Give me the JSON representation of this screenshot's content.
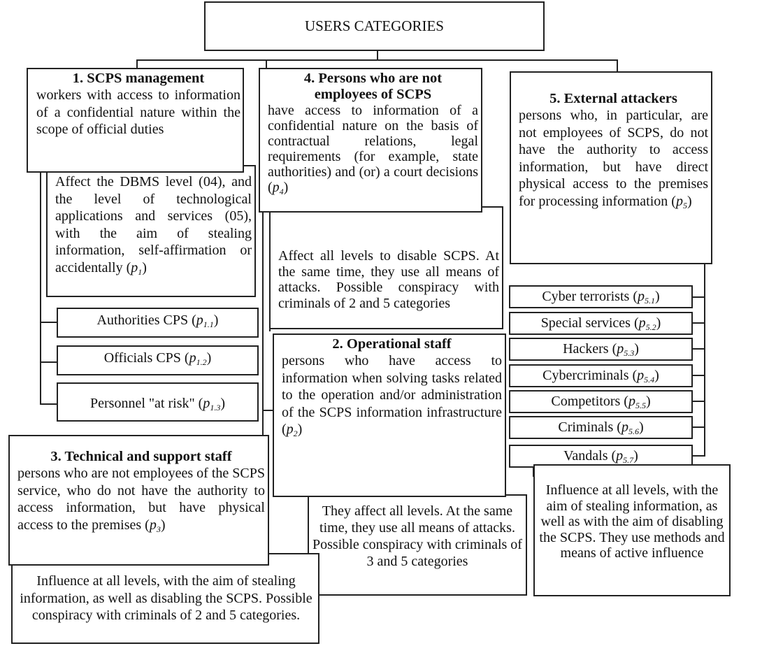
{
  "root": {
    "title": "USERS CATEGORIES"
  },
  "categories": {
    "c1": {
      "title": "1. SCPS management",
      "description": "workers with access to information of a confidential nature within the scope of official duties",
      "impact": "Affect the DBMS level (04), and the level of technological applications and services (05), with the aim of stealing information, self-affirmation or accidentally",
      "impact_param": "p",
      "impact_param_sub": "1",
      "subtypes": [
        {
          "label": "Authorities  CPS",
          "param": "p",
          "sub": "1.1"
        },
        {
          "label": "Officials CPS",
          "param": "p",
          "sub": "1.2"
        },
        {
          "label": "Personnel \"at risk\"",
          "param": "p",
          "sub": "1.3"
        }
      ]
    },
    "c4": {
      "title_line1": "4. Persons who are not",
      "title_line2": "employees of SCPS",
      "description": "have access to information of a confidential nature on the basis of contractual relations, legal requirements (for example, state authorities) and (or) a court decisions",
      "param": "p",
      "param_sub": "4",
      "impact": "Affect all levels to disable SCPS. At the same time, they use all means of attacks. Possible conspiracy with criminals of 2 and 5 categories"
    },
    "c5": {
      "title": "5. External attackers",
      "description": "persons who, in particular, are not employees of SCPS, do not have the authority to access information, but have direct physical access to the premises for processing information",
      "param": "p",
      "param_sub": "5",
      "subtypes": [
        {
          "label": "Cyber terrorists",
          "param": "p",
          "sub": "5.1"
        },
        {
          "label": "Special services",
          "param": "p",
          "sub": "5.2"
        },
        {
          "label": "Hackers",
          "param": "p",
          "sub": "5.3"
        },
        {
          "label": "Cybercriminals",
          "param": "p",
          "sub": "5.4"
        },
        {
          "label": "Competitors",
          "param": "p",
          "sub": "5.5"
        },
        {
          "label": "Criminals",
          "param": "p",
          "sub": "5.6"
        },
        {
          "label": "Vandals",
          "param": "p",
          "sub": "5.7"
        }
      ],
      "impact": "Influence at all levels, with the aim of stealing information, as well as with the aim of disabling the SCPS. They use methods and means of active influence"
    },
    "c2": {
      "title": "2. Operational staff",
      "description": "persons who have access to information when solving tasks related to the operation and/or administration of the SCPS information infrastructure",
      "param": "p",
      "param_sub": "2",
      "impact": "They affect all levels. At the same time, they use all means of attacks. Possible conspiracy with criminals of 3 and 5 categories"
    },
    "c3": {
      "title": "3. Technical and support staff",
      "description": "persons who are not employees of the SCPS service, who do not have the authority to access information, but have physical access to the premises",
      "param": "p",
      "param_sub": "3",
      "impact": "Influence at all levels, with the aim of stealing information, as well as disabling the SCPS. Possible conspiracy with criminals of 2 and 5 categories."
    }
  }
}
